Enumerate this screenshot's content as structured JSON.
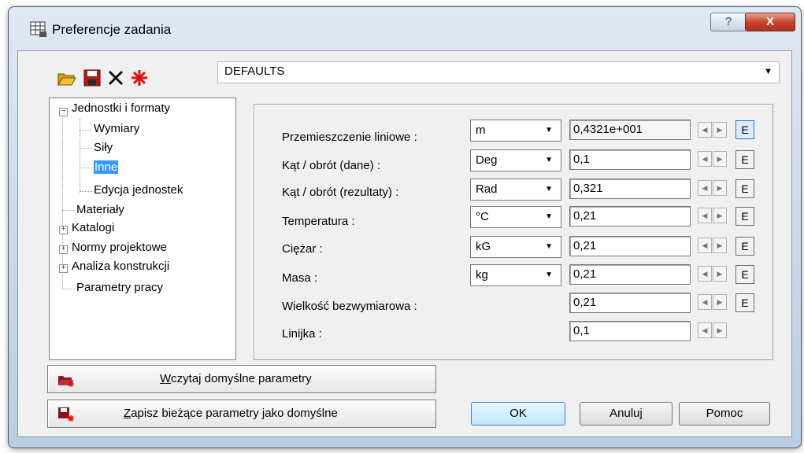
{
  "window": {
    "title": "Preferencje zadania"
  },
  "titlebar": {
    "help_label": "?",
    "close_label": "X"
  },
  "toolbar": {
    "profile_value": "DEFAULTS"
  },
  "tree": {
    "items": [
      {
        "label": "Jednostki i formaty",
        "expander": "−"
      },
      {
        "label": "Wymiary"
      },
      {
        "label": "Siły"
      },
      {
        "label": "Inne"
      },
      {
        "label": "Edycja jednostek"
      },
      {
        "label": "Materiały"
      },
      {
        "label": "Katalogi",
        "expander": "+"
      },
      {
        "label": "Normy projektowe",
        "expander": "+"
      },
      {
        "label": "Analiza konstrukcji",
        "expander": "+"
      },
      {
        "label": "Parametry pracy"
      }
    ],
    "selected": "Inne"
  },
  "units": {
    "rows": [
      {
        "label": "Przemieszczenie liniowe :",
        "unit": "m",
        "value": "0,4321e+001",
        "has_e": true
      },
      {
        "label": "Kąt / obrót (dane) :",
        "unit": "Deg",
        "value": "0,1",
        "has_e": true
      },
      {
        "label": "Kąt / obrót (rezultaty) :",
        "unit": "Rad",
        "value": "0,321",
        "has_e": true
      },
      {
        "label": "Temperatura :",
        "unit": "°C",
        "value": "0,21",
        "has_e": true
      },
      {
        "label": "Ciężar :",
        "unit": "kG",
        "value": "0,21",
        "has_e": true
      },
      {
        "label": "Masa :",
        "unit": "kg",
        "value": "0,21",
        "has_e": true
      },
      {
        "label": "Wielkość bezwymiarowa :",
        "unit": "",
        "value": "0,21",
        "has_e": true
      },
      {
        "label": "Linijka :",
        "unit": "",
        "value": "0,1",
        "has_e": false
      }
    ],
    "e_label": "E"
  },
  "buttons": {
    "load_defaults_pre": "",
    "load_defaults_mnemonic": "W",
    "load_defaults_rest": "czytaj domyślne parametry",
    "save_defaults_mnemonic": "Z",
    "save_defaults_rest": "apisz bieżące parametry jako domyślne",
    "ok": "OK",
    "cancel": "Anuluj",
    "help": "Pomoc"
  },
  "colors": {
    "selection": "#3399ff",
    "close": "#c4402a"
  }
}
